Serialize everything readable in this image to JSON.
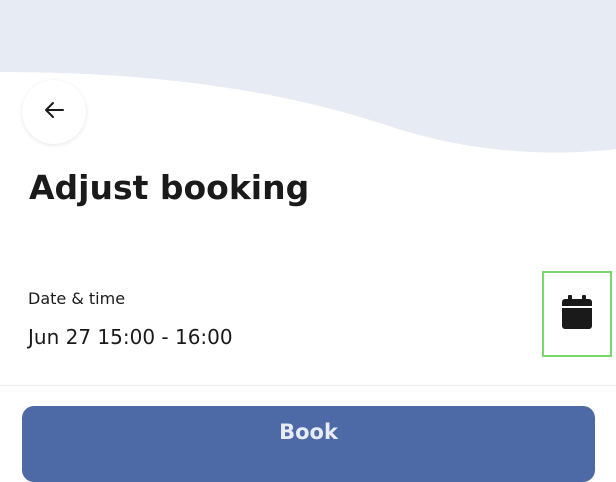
{
  "header": {
    "back_icon": "arrow-left-icon",
    "wave_color": "#e6ebf4"
  },
  "page": {
    "title": "Adjust booking"
  },
  "datetime": {
    "label": "Date & time",
    "value": "Jun 27 15:00 - 16:00",
    "calendar_icon": "calendar-icon",
    "highlight_color": "#7bd66f"
  },
  "actions": {
    "book_label": "Book",
    "book_color": "#4d6aa6"
  }
}
